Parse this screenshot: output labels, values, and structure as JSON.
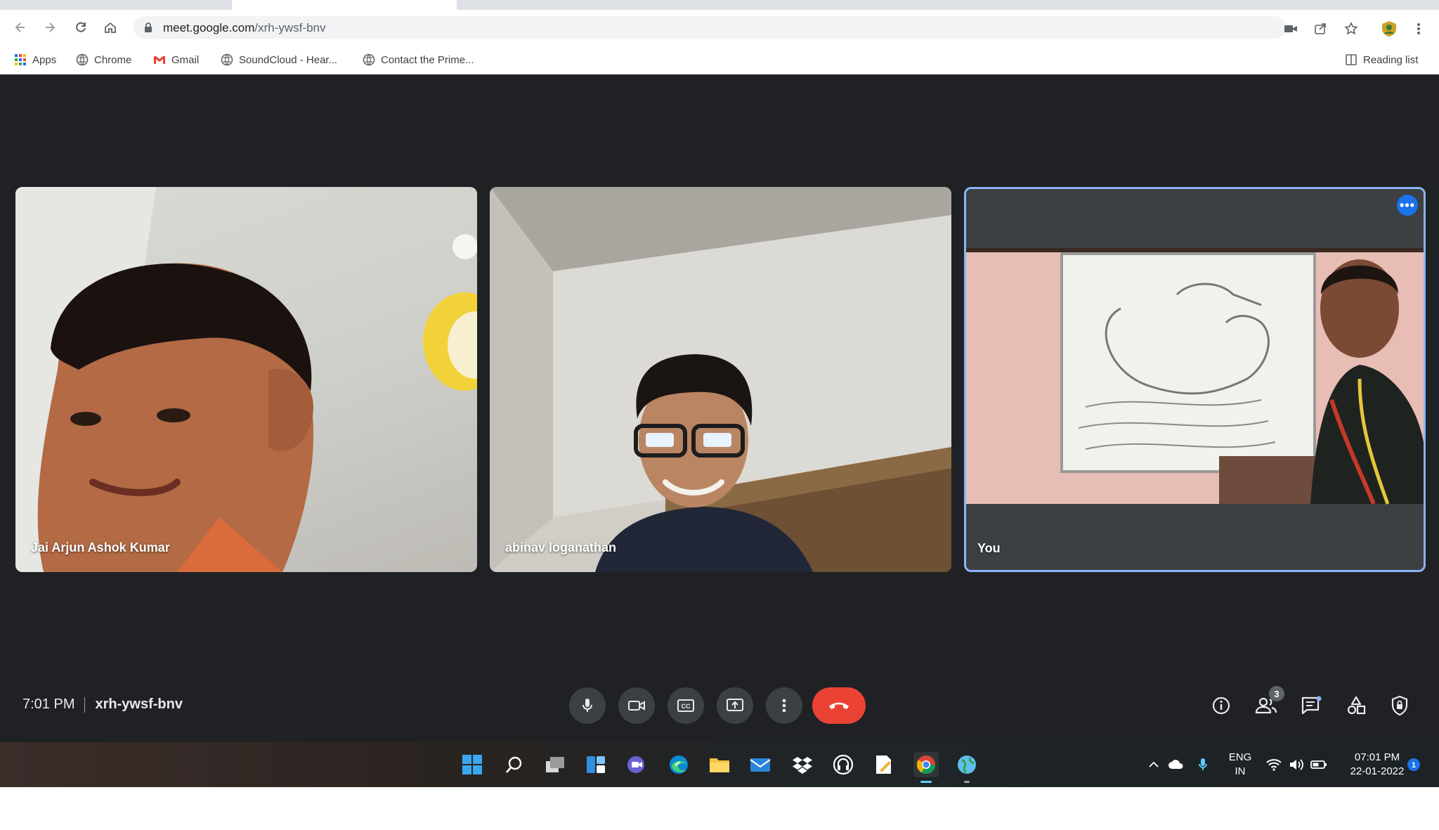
{
  "browser": {
    "url_host": "meet.google.com",
    "url_path": "/xrh-ywsf-bnv",
    "bookmarks": [
      {
        "label": "Apps",
        "icon": "apps-grid-icon"
      },
      {
        "label": "Chrome",
        "icon": "globe-icon"
      },
      {
        "label": "Gmail",
        "icon": "gmail-icon"
      },
      {
        "label": "SoundCloud - Hear...",
        "icon": "globe-icon"
      },
      {
        "label": "Contact the Prime...",
        "icon": "globe-icon"
      }
    ],
    "reading_list_label": "Reading list"
  },
  "meet": {
    "participants": [
      {
        "name": "Jai Arjun Ashok Kumar"
      },
      {
        "name": "abinav loganathan"
      },
      {
        "name": "You"
      }
    ],
    "time": "7:01 PM",
    "meeting_code": "xrh-ywsf-bnv",
    "people_count": "3",
    "accent_blue": "#1a73e8",
    "hangup_red": "#ea4335"
  },
  "taskbar": {
    "language_line1": "ENG",
    "language_line2": "IN",
    "clock_time": "07:01 PM",
    "clock_date": "22-01-2022"
  }
}
